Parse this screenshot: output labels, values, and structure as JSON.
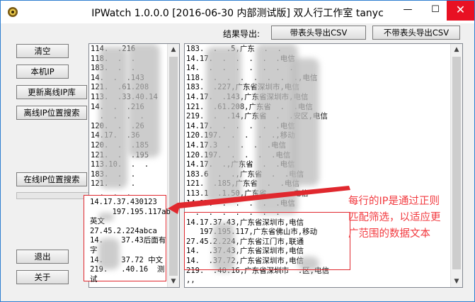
{
  "window": {
    "title": "IPWatch 1.0.0.0 [2016-06-30 内部测试版] 双人行工作室 tanyc",
    "minimize_label": "—",
    "maximize_label": "☐",
    "close_label": "✕"
  },
  "buttons": {
    "clear": "清空",
    "local_ip": "本机IP",
    "update_offline": "更新离线IP库",
    "offline_search": "离线IP位置搜索",
    "online_search": "在线IP位置搜索",
    "exit": "退出",
    "about": "关于"
  },
  "export": {
    "label": "结果导出:",
    "with_header": "带表头导出CSV",
    "without_header": "不带表头导出CSV"
  },
  "input_list": {
    "lines": [
      "114.  .216",
      "118.  .  .",
      "183.  .  .",
      "14.  .  .143",
      "121.  .61.208",
      "113.  .33.40.14",
      "14.  .  .216",
      "  .  .  .  .",
      "120.  .  .26",
      "14.17.  .36",
      "120.  .  .185",
      "121.  .  .195",
      "113.10.  .  .",
      "183.  .  .",
      "121.  .  .",
      "  .  .  .",
      "14.  .  .36"
    ],
    "highlighted_lines": [
      "14.17.37.430123",
      "     197.195.117ab",
      "英文",
      "27.45.2.224abca",
      "14.    37.43后面有",
      "字",
      "14.    37.72 中文",
      "219.   .40.16  测",
      "试"
    ]
  },
  "result_list": {
    "lines": [
      "183.  .  .5,广东  .  .",
      "14.17.  .  .  .  .  .电信",
      "14.  .  .  .  .  .  .  .",
      "118.  .  .  .  .  .  .  .,电信",
      "183.  .227,广东省深圳市,电信",
      "14.17.  .143,广东省深圳市,电信",
      "121.  .61.208,广东省  .  .电信",
      "219.  .  .14,广东省  .  .安区,电信",
      "14.17.  .  .  .  .  .电信",
      "120.197.  .  .  .  .,移动",
      "14.17.3  .  .  .  .电信",
      "120.197.  .  .  .  .电信",
      "14.17.  .,广东省  .  .电信",
      "183.6  .  .,广东省  .  .电信",
      "121.  .185,广东省  .  .电信",
      "113.1  .1.50,广东省  .  .电信",
      "14.17.  .  .  .  .  .电信",
      "  .  .  .  .  .  .  .",
      "14.17.37.43,广东省深圳市,电信",
      "   197.195.117,广东省佛山市,移动",
      "27.45.2.224,广东省江门市,联通",
      "14.  .37.43,广东省深圳市,电信",
      "14.  .37.72,广东省深圳市,电信",
      "219.  .40.16,广东省深圳市  .区,电信",
      ",,"
    ]
  },
  "annotation": {
    "text_line1": "每行的IP是通过正则",
    "text_line2": "匹配筛选，以适应更",
    "text_line3": "广范围的数据文本"
  },
  "colors": {
    "accent": "#e0282e",
    "close_bg": "#e81123"
  }
}
